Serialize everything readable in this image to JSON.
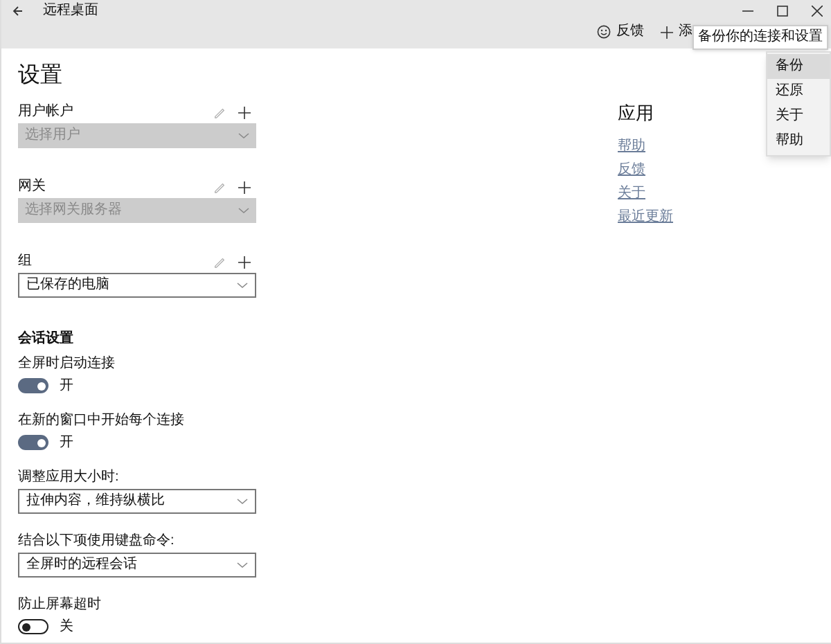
{
  "window": {
    "title": "远程桌面"
  },
  "toolbar": [
    {
      "kind": "feedback",
      "label": "反馈"
    },
    {
      "kind": "add",
      "label": "添"
    }
  ],
  "tooltip": "备份你的连接和设置",
  "menu": [
    {
      "label": "备份",
      "selected": true
    },
    {
      "label": "还原",
      "selected": false
    },
    {
      "label": "关于",
      "selected": false
    },
    {
      "label": "帮助",
      "selected": false
    }
  ],
  "page_title": "设置",
  "pickers": [
    {
      "label": "用户帐户",
      "placeholder": "选择用户",
      "disabled": true
    },
    {
      "label": "网关",
      "placeholder": "选择网关服务器",
      "disabled": true
    },
    {
      "label": "组",
      "value": "已保存的电脑",
      "disabled": false
    }
  ],
  "session": {
    "heading": "会话设置",
    "items": [
      {
        "kind": "toggle",
        "label": "全屏时启动连接",
        "on": true,
        "state_text": "开"
      },
      {
        "kind": "toggle",
        "label": "在新的窗口中开始每个连接",
        "on": true,
        "state_text": "开"
      },
      {
        "kind": "dropdown",
        "label": "调整应用大小时:",
        "value": "拉伸内容，维持纵横比"
      },
      {
        "kind": "dropdown",
        "label": "结合以下项使用键盘命令:",
        "value": "全屏时的远程会话"
      },
      {
        "kind": "toggle",
        "label": "防止屏幕超时",
        "on": false,
        "state_text": "关"
      }
    ]
  },
  "app": {
    "heading": "应用",
    "links": [
      "帮助",
      "反馈",
      "关于",
      "最近更新"
    ]
  }
}
